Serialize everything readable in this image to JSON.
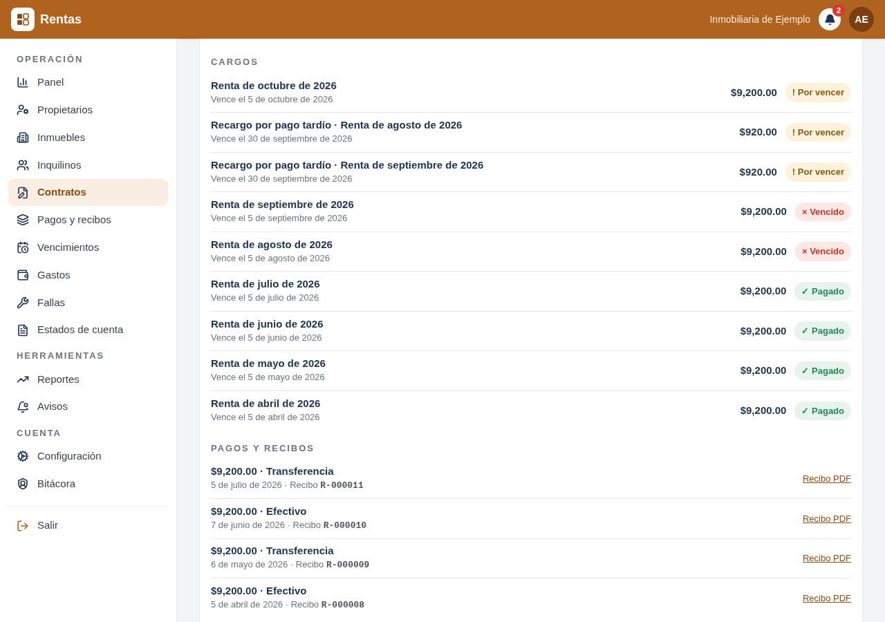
{
  "header": {
    "app_name": "Rentas",
    "organization": "Inmobiliaria de Ejemplo",
    "notification_count": "2",
    "avatar_initials": "AE"
  },
  "sidebar": {
    "sections": [
      {
        "title": "OPERACIÓN",
        "items": [
          {
            "label": "Panel",
            "selected": false
          },
          {
            "label": "Propietarios",
            "selected": false
          },
          {
            "label": "Inmuebles",
            "selected": false
          },
          {
            "label": "Inquilinos",
            "selected": false
          },
          {
            "label": "Contratos",
            "selected": true
          },
          {
            "label": "Pagos y recibos",
            "selected": false
          },
          {
            "label": "Vencimientos",
            "selected": false
          },
          {
            "label": "Gastos",
            "selected": false
          },
          {
            "label": "Fallas",
            "selected": false
          },
          {
            "label": "Estados de cuenta",
            "selected": false
          }
        ]
      },
      {
        "title": "HERRAMIENTAS",
        "items": [
          {
            "label": "Reportes",
            "selected": false
          },
          {
            "label": "Avisos",
            "selected": false
          }
        ]
      },
      {
        "title": "CUENTA",
        "items": [
          {
            "label": "Configuración",
            "selected": false
          },
          {
            "label": "Bitácora",
            "selected": false
          }
        ]
      }
    ],
    "logout": {
      "label": "Salir"
    }
  },
  "charges": {
    "title": "CARGOS",
    "rows": [
      {
        "concept": "Renta de octubre de 2026",
        "due": "Vence el 5 de octubre de 2026",
        "amount": "$9,200.00",
        "kind": "due",
        "status_label": "! Por vencer"
      },
      {
        "concept": "Recargo por pago tardío · Renta de agosto de 2026",
        "due": "Vence el 30 de septiembre de 2026",
        "amount": "$920.00",
        "kind": "due",
        "status_label": "! Por vencer"
      },
      {
        "concept": "Recargo por pago tardío · Renta de septiembre de 2026",
        "due": "Vence el 30 de septiembre de 2026",
        "amount": "$920.00",
        "kind": "due",
        "status_label": "! Por vencer"
      },
      {
        "concept": "Renta de septiembre de 2026",
        "due": "Vence el 5 de septiembre de 2026",
        "amount": "$9,200.00",
        "kind": "overdue",
        "status_label": "× Vencido"
      },
      {
        "concept": "Renta de agosto de 2026",
        "due": "Vence el 5 de agosto de 2026",
        "amount": "$9,200.00",
        "kind": "overdue",
        "status_label": "× Vencido"
      },
      {
        "concept": "Renta de julio de 2026",
        "due": "Vence el 5 de julio de 2026",
        "amount": "$9,200.00",
        "kind": "paid",
        "status_label": "✓ Pagado"
      },
      {
        "concept": "Renta de junio de 2026",
        "due": "Vence el 5 de junio de 2026",
        "amount": "$9,200.00",
        "kind": "paid",
        "status_label": "✓ Pagado"
      },
      {
        "concept": "Renta de mayo de 2026",
        "due": "Vence el 5 de mayo de 2026",
        "amount": "$9,200.00",
        "kind": "paid",
        "status_label": "✓ Pagado"
      },
      {
        "concept": "Renta de abril de 2026",
        "due": "Vence el 5 de abril de 2026",
        "amount": "$9,200.00",
        "kind": "paid",
        "status_label": "✓ Pagado"
      }
    ]
  },
  "payments": {
    "title": "PAGOS Y RECIBOS",
    "rows": [
      {
        "summary": "$9,200.00 · Transferencia",
        "detail": "5 de julio de 2026 · Recibo",
        "receipt": "R-000011",
        "link": "Recibo PDF"
      },
      {
        "summary": "$9,200.00 · Efectivo",
        "detail": "7 de junio de 2026 · Recibo",
        "receipt": "R-000010",
        "link": "Recibo PDF"
      },
      {
        "summary": "$9,200.00 · Transferencia",
        "detail": "6 de mayo de 2026 · Recibo",
        "receipt": "R-000009",
        "link": "Recibo PDF"
      },
      {
        "summary": "$9,200.00 · Efectivo",
        "detail": "5 de abril de 2026 · Recibo",
        "receipt": "R-000008",
        "link": "Recibo PDF"
      }
    ]
  }
}
